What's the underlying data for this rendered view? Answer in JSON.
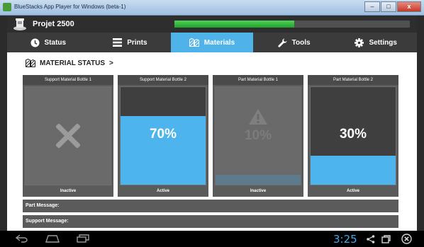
{
  "window": {
    "title": "BlueStacks App Player for Windows (beta-1)"
  },
  "header": {
    "printer_name": "Projet 2500",
    "progress_percent": 51
  },
  "tabs": [
    {
      "label": "Status",
      "icon": "clock-icon"
    },
    {
      "label": "Prints",
      "icon": "list-icon"
    },
    {
      "label": "Materials",
      "icon": "materials-icon",
      "active": true
    },
    {
      "label": "Tools",
      "icon": "wrench-icon"
    },
    {
      "label": "Settings",
      "icon": "gear-icon"
    }
  ],
  "materials": {
    "heading": "MATERIAL STATUS",
    "heading_arrow": ">",
    "bottles": [
      {
        "title": "Support Material Bottle 1",
        "status": "Inactive",
        "level": null,
        "display": "x-icon"
      },
      {
        "title": "Support Material Bottle 2",
        "status": "Active",
        "level": 70,
        "label": "70%"
      },
      {
        "title": "Part Material Bottle 1",
        "status": "Inactive",
        "level": 10,
        "label": "10%",
        "display": "warning-icon"
      },
      {
        "title": "Part Material Bottle 2",
        "status": "Active",
        "level": 30,
        "label": "30%"
      }
    ],
    "part_message_label": "Part Message:",
    "support_message_label": "Support Message:"
  },
  "navbar": {
    "clock": "3:25"
  },
  "colors": {
    "accent": "#4fb3ea",
    "progress": "#2fb63a",
    "clock": "#46a6e6"
  }
}
